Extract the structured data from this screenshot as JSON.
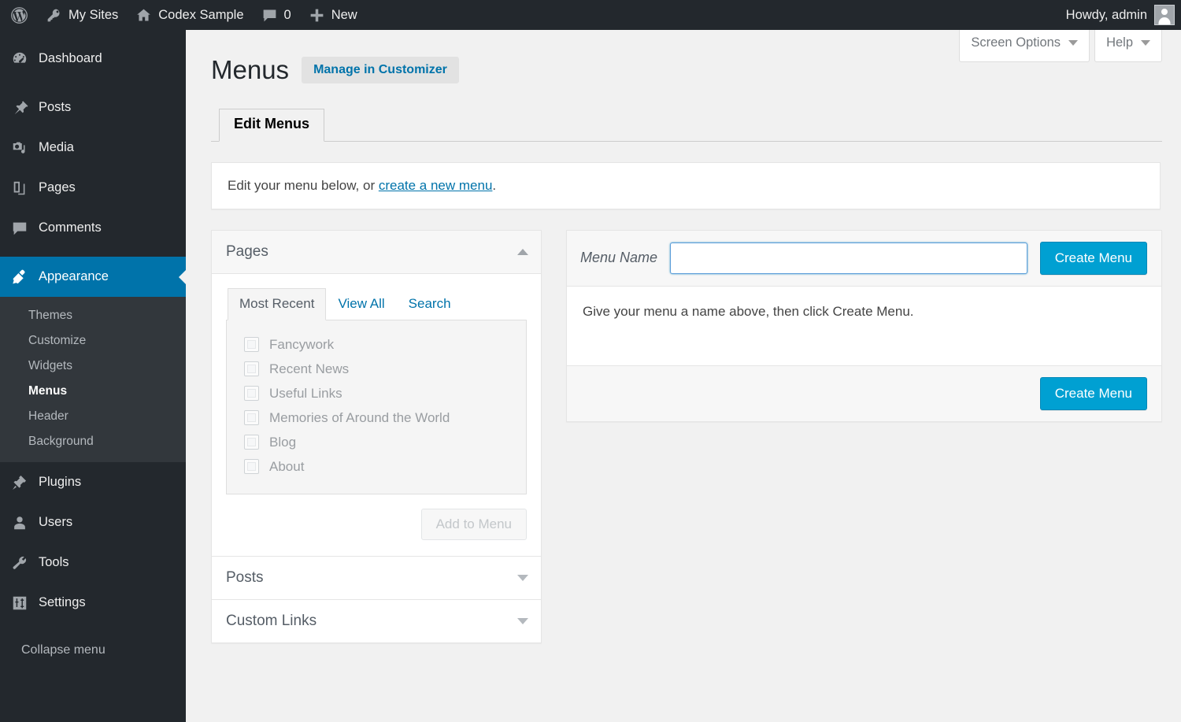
{
  "adminbar": {
    "logo_icon": "wordpress-logo-icon",
    "items": [
      {
        "label": "My Sites",
        "icon": "key-icon"
      },
      {
        "label": "Codex Sample",
        "icon": "home-icon"
      },
      {
        "label": "0",
        "icon": "comment-bubble-icon"
      },
      {
        "label": "New",
        "icon": "plus-icon"
      }
    ],
    "howdy": "Howdy, admin",
    "avatar_icon": "user-avatar-icon"
  },
  "sidebar": {
    "items": [
      {
        "label": "Dashboard",
        "icon": "dashboard-icon",
        "current": false
      },
      {
        "label": "Posts",
        "icon": "pin-icon",
        "current": false
      },
      {
        "label": "Media",
        "icon": "media-icon",
        "current": false
      },
      {
        "label": "Pages",
        "icon": "pages-icon",
        "current": false
      },
      {
        "label": "Comments",
        "icon": "comments-icon",
        "current": false
      },
      {
        "label": "Appearance",
        "icon": "appearance-brush-icon",
        "current": true
      },
      {
        "label": "Plugins",
        "icon": "plugins-plug-icon",
        "current": false
      },
      {
        "label": "Users",
        "icon": "users-icon",
        "current": false
      },
      {
        "label": "Tools",
        "icon": "tools-wrench-icon",
        "current": false
      },
      {
        "label": "Settings",
        "icon": "settings-sliders-icon",
        "current": false
      }
    ],
    "appearance_submenu": [
      {
        "label": "Themes",
        "current": false
      },
      {
        "label": "Customize",
        "current": false
      },
      {
        "label": "Widgets",
        "current": false
      },
      {
        "label": "Menus",
        "current": true
      },
      {
        "label": "Header",
        "current": false
      },
      {
        "label": "Background",
        "current": false
      }
    ],
    "collapse": {
      "label": "Collapse menu",
      "icon": "collapse-arrow-icon"
    }
  },
  "screen_meta": {
    "screen_options": "Screen Options",
    "help": "Help"
  },
  "header": {
    "page_title": "Menus",
    "customizer_button": "Manage in Customizer"
  },
  "tabs": [
    {
      "label": "Edit Menus",
      "active": true
    }
  ],
  "notice": {
    "text_before": "Edit your menu below, or ",
    "link": "create a new menu",
    "text_after": "."
  },
  "pages_panel": {
    "title": "Pages",
    "collapse_icon": "chevron-up-icon",
    "tabs": [
      {
        "label": "Most Recent",
        "active": true
      },
      {
        "label": "View All",
        "active": false
      },
      {
        "label": "Search",
        "active": false
      }
    ],
    "items": [
      {
        "label": "Fancywork",
        "checked": false
      },
      {
        "label": "Recent News",
        "checked": false
      },
      {
        "label": "Useful Links",
        "checked": false
      },
      {
        "label": "Memories of Around the World",
        "checked": false
      },
      {
        "label": "Blog",
        "checked": false
      },
      {
        "label": "About",
        "checked": false
      }
    ],
    "add_button": "Add to Menu"
  },
  "posts_panel": {
    "title": "Posts",
    "collapse_icon": "chevron-down-icon"
  },
  "custom_links_panel": {
    "title": "Custom Links",
    "collapse_icon": "chevron-down-icon"
  },
  "menu_settings": {
    "name_label": "Menu Name",
    "name_value": "",
    "name_placeholder": "",
    "create_button_top": "Create Menu",
    "instructions": "Give your menu a name above, then click Create Menu.",
    "create_button_bottom": "Create Menu"
  },
  "colors": {
    "admin_bar": "#23282d",
    "sidebar": "#23282d",
    "submenu": "#32373c",
    "current_highlight": "#0073aa",
    "primary_button": "#00a0d2",
    "link": "#0073aa",
    "content_bg": "#f1f1f1"
  }
}
